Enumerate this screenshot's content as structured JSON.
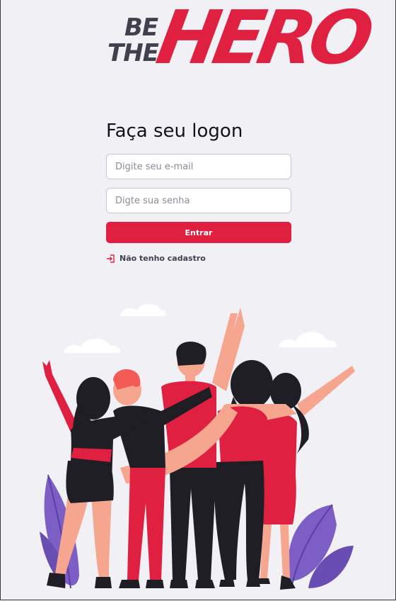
{
  "logo": {
    "be": "BE",
    "the": "THE",
    "hero": "HERO"
  },
  "form": {
    "title": "Faça seu logon",
    "email_placeholder": "Digite seu e-mail",
    "password_placeholder": "Digte sua senha",
    "submit_label": "Entrar",
    "register_link_label": "Não tenho cadastro",
    "register_icon": "log-in-icon"
  },
  "colors": {
    "background": "#f0f0f5",
    "brand": "#e02041",
    "dark": "#41414d"
  },
  "illustration": {
    "name": "heroes-illustration",
    "people_count": 5
  }
}
